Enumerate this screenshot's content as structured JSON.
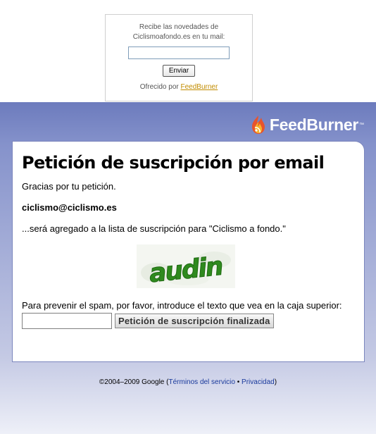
{
  "widget": {
    "intro_line1": "Recibe las novedades de",
    "intro_line2": "Ciclismoafondo.es en tu mail:",
    "email_value": "",
    "send_label": "Enviar",
    "offered_prefix": "Ofrecido por ",
    "feedburner_link": "FeedBurner"
  },
  "page": {
    "logo_text": "FeedBurner",
    "logo_tm": "™",
    "title": "Petición de suscripción por email",
    "thanks": "Gracias por tu petición.",
    "email": "ciclismo@ciclismo.es",
    "added": "...será agregado a la lista de suscripción para \"Ciclismo a fondo.\"",
    "captcha_text": "audin",
    "spam_note": "Para prevenir el spam, por favor, introduce el texto que vea en la caja superior:",
    "captcha_value": "",
    "submit_label": "Petición de suscripción finalizada"
  },
  "footer": {
    "copyright": "©2004–2009 Google (",
    "terms": "Términos del servicio",
    "separator": " • ",
    "privacy": "Privacidad",
    "close": ")"
  },
  "colors": {
    "header_blue": "#6c7bbd",
    "link_gold": "#c28c00",
    "captcha_green": "#2f8a1e"
  },
  "icons": {
    "logo": "feedburner-flame-icon"
  }
}
